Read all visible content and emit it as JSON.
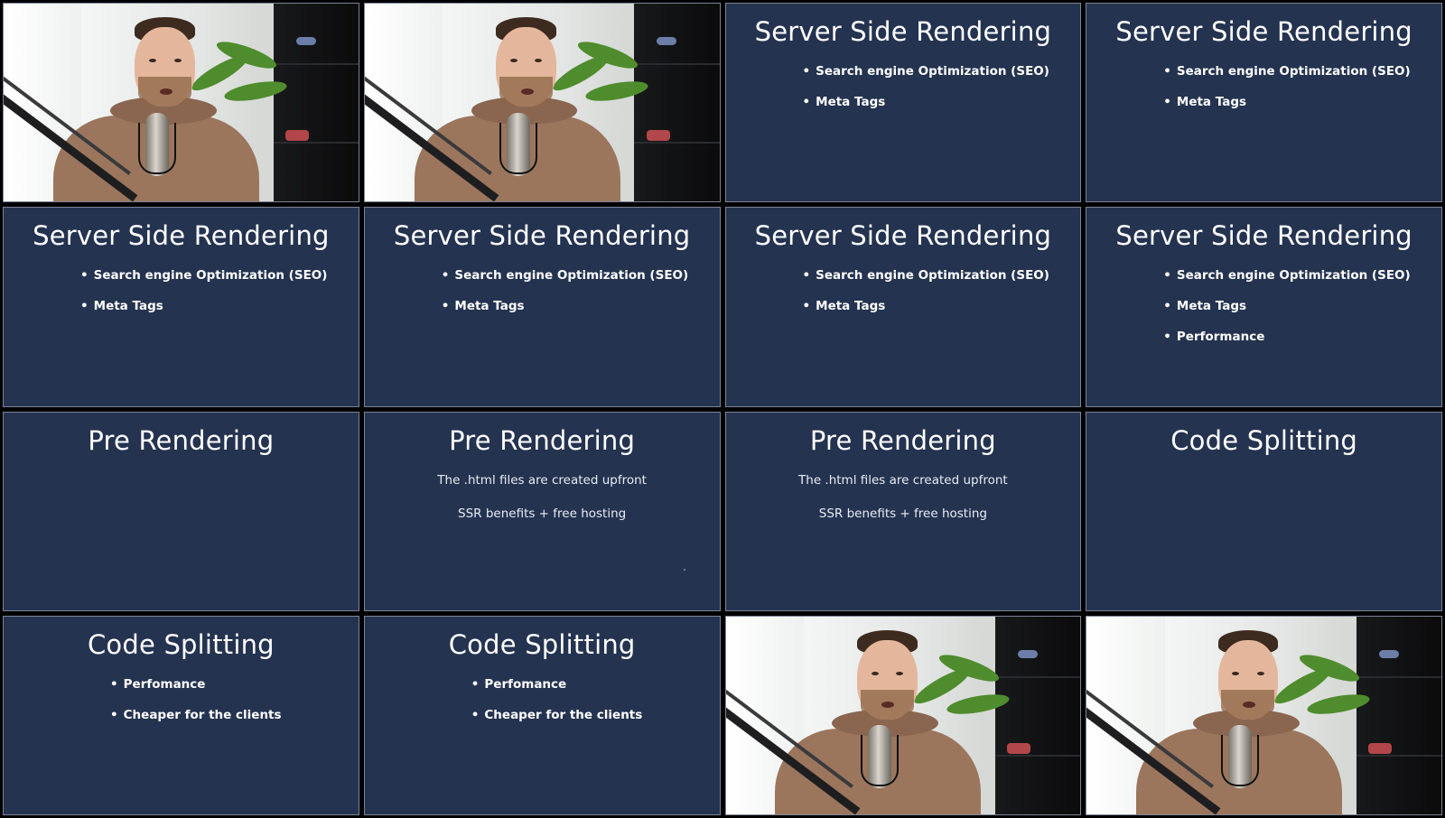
{
  "tiles": [
    {
      "kind": "webcam"
    },
    {
      "kind": "webcam"
    },
    {
      "kind": "slide",
      "title": "Server Side Rendering",
      "bullets": [
        "Search engine Optimization (SEO)",
        "Meta Tags"
      ]
    },
    {
      "kind": "slide",
      "title": "Server Side Rendering",
      "bullets": [
        "Search engine Optimization (SEO)",
        "Meta Tags"
      ]
    },
    {
      "kind": "slide",
      "title": "Server Side Rendering",
      "bullets": [
        "Search engine Optimization (SEO)",
        "Meta Tags"
      ]
    },
    {
      "kind": "slide",
      "title": "Server Side Rendering",
      "bullets": [
        "Search engine Optimization (SEO)",
        "Meta Tags"
      ]
    },
    {
      "kind": "slide",
      "title": "Server Side Rendering",
      "bullets": [
        "Search engine Optimization (SEO)",
        "Meta Tags"
      ]
    },
    {
      "kind": "slide",
      "title": "Server Side Rendering",
      "bullets": [
        "Search engine Optimization (SEO)",
        "Meta Tags",
        "Performance"
      ]
    },
    {
      "kind": "slide",
      "title": "Pre Rendering"
    },
    {
      "kind": "slide",
      "title": "Pre Rendering",
      "lines": [
        "The .html files are created upfront",
        "SSR benefits + free hosting"
      ]
    },
    {
      "kind": "slide",
      "title": "Pre Rendering",
      "lines": [
        "The .html files are created upfront",
        "SSR benefits + free hosting"
      ]
    },
    {
      "kind": "slide",
      "title": "Code Splitting"
    },
    {
      "kind": "slide",
      "title": "Code Splitting",
      "bullets": [
        "Perfomance",
        "Cheaper for the clients"
      ]
    },
    {
      "kind": "slide",
      "title": "Code Splitting",
      "bullets": [
        "Perfomance",
        "Cheaper for the clients"
      ]
    },
    {
      "kind": "webcam"
    },
    {
      "kind": "webcam"
    }
  ],
  "colors": {
    "slide_bg": "#243350",
    "frame_bg": "#000000"
  }
}
